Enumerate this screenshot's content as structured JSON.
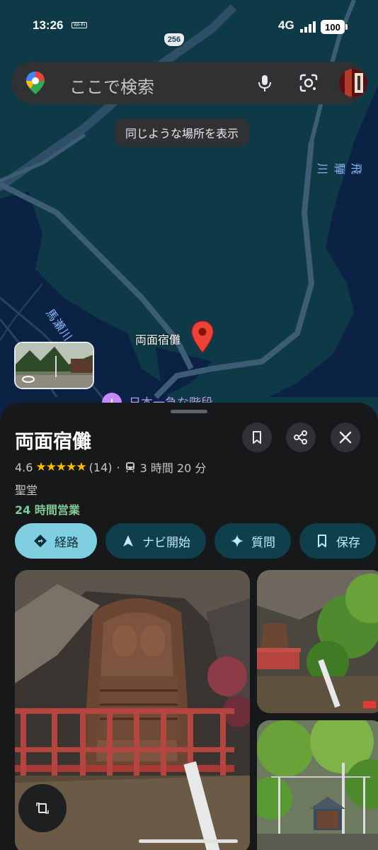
{
  "status": {
    "time": "13:26",
    "wifi": "Wi-Fi",
    "network": "4G",
    "battery": "100"
  },
  "map": {
    "route_number": "256",
    "river_label": "馬瀬川",
    "river2_label": "飛騨川",
    "place_label": "両面宿儺",
    "poi_label": "日本一急な階段"
  },
  "search": {
    "placeholder": "ここで検索",
    "icons": [
      "maps-pin-icon",
      "mic-icon",
      "lens-icon",
      "avatar"
    ]
  },
  "similar_places_label": "同じような場所を表示",
  "place": {
    "name": "両面宿儺",
    "rating": "4.6",
    "stars": "★★★★★",
    "review_count": "(14)",
    "separator": "·",
    "transit_time": "3 時間 20 分",
    "category": "聖堂",
    "hours": "24 時間営業"
  },
  "actions": [
    {
      "label": "経路",
      "icon": "directions-icon"
    },
    {
      "label": "ナビ開始",
      "icon": "navigation-icon"
    },
    {
      "label": "質問",
      "icon": "sparkle-icon"
    },
    {
      "label": "保存",
      "icon": "bookmark-icon"
    }
  ],
  "colors": {
    "accent": "#7fcfe0",
    "open_hours": "#81c995",
    "stars": "#fbbc04",
    "map_water": "#0d3544",
    "sheet_bg": "#17181a"
  }
}
